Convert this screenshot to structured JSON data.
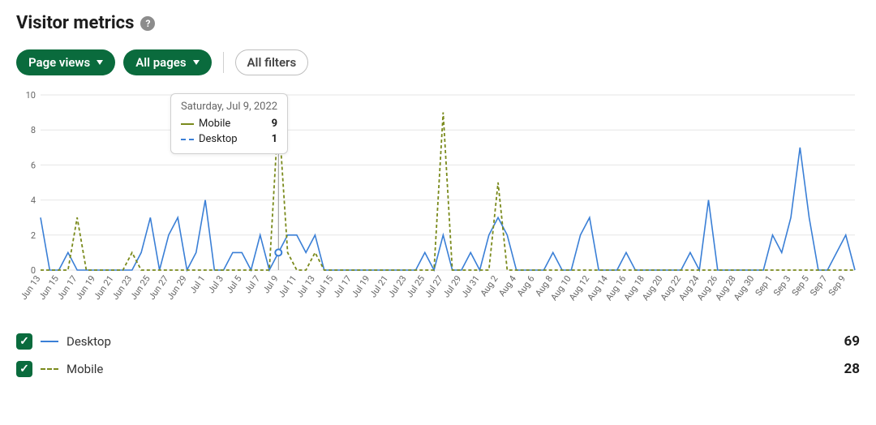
{
  "header": {
    "title": "Visitor metrics"
  },
  "filters": {
    "metric": "Page views",
    "pages": "All pages",
    "all_filters": "All filters"
  },
  "tooltip": {
    "date": "Saturday, Jul 9, 2022",
    "rows": [
      {
        "label": "Mobile",
        "value": 9
      },
      {
        "label": "Desktop",
        "value": 1
      }
    ]
  },
  "legend": {
    "desktop": {
      "label": "Desktop",
      "total": 69
    },
    "mobile": {
      "label": "Mobile",
      "total": 28
    }
  },
  "chart_data": {
    "type": "line",
    "title": "Visitor metrics — Page views",
    "xlabel": "",
    "ylabel": "",
    "ylim": [
      0,
      10
    ],
    "y_ticks": [
      0,
      2,
      4,
      6,
      8,
      10
    ],
    "hover_index": 26,
    "categories": [
      "Jun 13",
      "Jun 14",
      "Jun 15",
      "Jun 16",
      "Jun 17",
      "Jun 18",
      "Jun 19",
      "Jun 20",
      "Jun 21",
      "Jun 22",
      "Jun 23",
      "Jun 24",
      "Jun 25",
      "Jun 26",
      "Jun 27",
      "Jun 28",
      "Jun 29",
      "Jun 30",
      "Jul 1",
      "Jul 2",
      "Jul 3",
      "Jul 4",
      "Jul 5",
      "Jul 6",
      "Jul 7",
      "Jul 8",
      "Jul 9",
      "Jul 10",
      "Jul 11",
      "Jul 12",
      "Jul 13",
      "Jul 14",
      "Jul 15",
      "Jul 16",
      "Jul 17",
      "Jul 18",
      "Jul 19",
      "Jul 20",
      "Jul 21",
      "Jul 22",
      "Jul 23",
      "Jul 24",
      "Jul 25",
      "Jul 26",
      "Jul 27",
      "Jul 28",
      "Jul 29",
      "Jul 30",
      "Jul 31",
      "Aug 1",
      "Aug 2",
      "Aug 3",
      "Aug 4",
      "Aug 5",
      "Aug 6",
      "Aug 7",
      "Aug 8",
      "Aug 9",
      "Aug 10",
      "Aug 11",
      "Aug 12",
      "Aug 13",
      "Aug 14",
      "Aug 15",
      "Aug 16",
      "Aug 17",
      "Aug 18",
      "Aug 19",
      "Aug 20",
      "Aug 21",
      "Aug 22",
      "Aug 23",
      "Aug 24",
      "Aug 25",
      "Aug 26",
      "Aug 27",
      "Aug 28",
      "Aug 29",
      "Aug 30",
      "Aug 31",
      "Sep 1",
      "Sep 2",
      "Sep 3",
      "Sep 4",
      "Sep 5",
      "Sep 6",
      "Sep 7",
      "Sep 8",
      "Sep 9",
      "Sep 10"
    ],
    "x_tick_labels": [
      "Jun 13",
      "Jun 15",
      "Jun 17",
      "Jun 19",
      "Jun 21",
      "Jun 23",
      "Jun 25",
      "Jun 27",
      "Jun 29",
      "Jul 1",
      "Jul 3",
      "Jul 5",
      "Jul 7",
      "Jul 9",
      "Jul 11",
      "Jul 13",
      "Jul 15",
      "Jul 17",
      "Jul 19",
      "Jul 21",
      "Jul 23",
      "Jul 25",
      "Jul 27",
      "Jul 29",
      "Jul 31",
      "Aug 2",
      "Aug 4",
      "Aug 6",
      "Aug 8",
      "Aug 10",
      "Aug 12",
      "Aug 14",
      "Aug 16",
      "Aug 18",
      "Aug 20",
      "Aug 22",
      "Aug 24",
      "Aug 26",
      "Aug 28",
      "Aug 30",
      "Sep 1",
      "Sep 3",
      "Sep 5",
      "Sep 7",
      "Sep 9"
    ],
    "series": [
      {
        "name": "Desktop",
        "color": "#3a7fd6",
        "style": "solid",
        "values": [
          3,
          0,
          0,
          1,
          0,
          0,
          0,
          0,
          0,
          0,
          0,
          1,
          3,
          0,
          2,
          3,
          0,
          1,
          4,
          0,
          0,
          1,
          1,
          0,
          2,
          0,
          1,
          2,
          2,
          1,
          2,
          0,
          0,
          0,
          0,
          0,
          0,
          0,
          0,
          0,
          0,
          0,
          1,
          0,
          2,
          0,
          0,
          1,
          0,
          2,
          3,
          2,
          0,
          0,
          0,
          0,
          1,
          0,
          0,
          2,
          3,
          0,
          0,
          0,
          1,
          0,
          0,
          0,
          0,
          0,
          0,
          1,
          0,
          4,
          0,
          0,
          0,
          0,
          0,
          0,
          2,
          1,
          3,
          7,
          3,
          0,
          0,
          1,
          2,
          0
        ]
      },
      {
        "name": "Mobile",
        "color": "#7a8a1c",
        "style": "dashed",
        "values": [
          0,
          0,
          0,
          0,
          3,
          0,
          0,
          0,
          0,
          0,
          1,
          0,
          0,
          0,
          0,
          0,
          0,
          0,
          0,
          0,
          0,
          0,
          0,
          0,
          0,
          0,
          9,
          1,
          0,
          0,
          1,
          0,
          0,
          0,
          0,
          0,
          0,
          0,
          0,
          0,
          0,
          0,
          0,
          0,
          9,
          0,
          0,
          0,
          0,
          0,
          5,
          0,
          0,
          0,
          0,
          0,
          0,
          0,
          0,
          0,
          0,
          0,
          0,
          0,
          0,
          0,
          0,
          0,
          0,
          0,
          0,
          0,
          0,
          0,
          0,
          0,
          0,
          0,
          0,
          0,
          0,
          0,
          0,
          0,
          0,
          0,
          0,
          0,
          0,
          0
        ]
      }
    ]
  }
}
